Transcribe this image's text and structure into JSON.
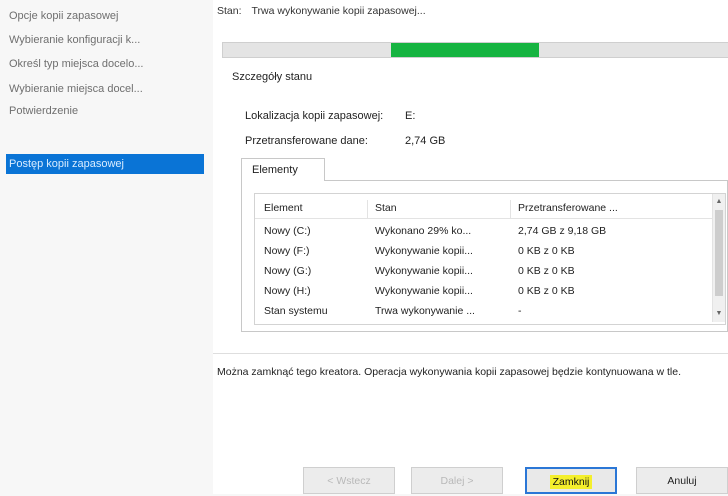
{
  "sidebar": {
    "items": [
      {
        "label": "Opcje kopii zapasowej"
      },
      {
        "label": "Wybieranie konfiguracji k..."
      },
      {
        "label": "Określ typ miejsca docelo..."
      },
      {
        "label": "Wybieranie miejsca docel..."
      },
      {
        "label": "Potwierdzenie"
      },
      {
        "label": "Postęp kopii zapasowej"
      }
    ],
    "active_index": 5
  },
  "status": {
    "label": "Stan:",
    "value": "Trwa wykonywanie kopii zapasowej..."
  },
  "progress": {
    "start_fraction": 0.33,
    "end_fraction": 0.62,
    "color": "#16b441"
  },
  "details": {
    "title": "Szczegóły stanu",
    "location_label": "Lokalizacja kopii zapasowej:",
    "location_value": "E:",
    "transferred_label": "Przetransferowane dane:",
    "transferred_value": "2,74 GB"
  },
  "tab": {
    "label": "Elementy"
  },
  "table": {
    "headers": [
      "Element",
      "Stan",
      "Przetransferowane ..."
    ],
    "rows": [
      [
        "Nowy (C:)",
        "Wykonano 29% ko...",
        "2,74 GB z 9,18 GB"
      ],
      [
        "Nowy (F:)",
        "Wykonywanie kopii...",
        "0 KB z 0 KB"
      ],
      [
        "Nowy (G:)",
        "Wykonywanie kopii...",
        "0 KB z 0 KB"
      ],
      [
        "Nowy (H:)",
        "Wykonywanie kopii...",
        "0 KB z 0 KB"
      ],
      [
        "Stan systemu",
        "Trwa wykonywanie ...",
        "-"
      ]
    ]
  },
  "info_text": "Można zamknąć tego kreatora. Operacja wykonywania kopii zapasowej będzie kontynuowana w tle.",
  "buttons": {
    "previous": "< Wstecz",
    "next": "Dalej >",
    "close": "Zamknij",
    "cancel": "Anuluj"
  }
}
